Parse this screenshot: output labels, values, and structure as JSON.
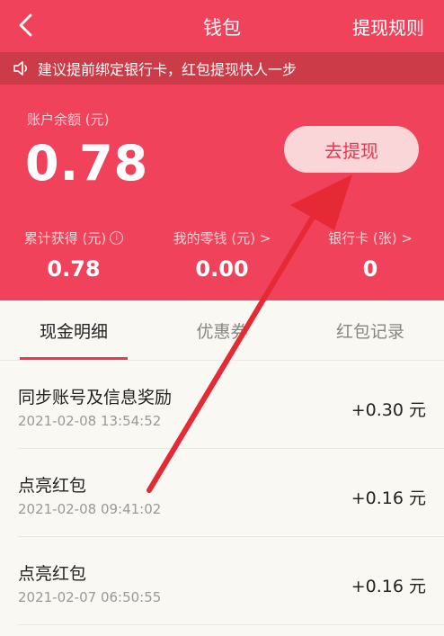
{
  "header": {
    "title": "钱包",
    "rules_label": "提现规则"
  },
  "notice": {
    "text": "建议提前绑定银行卡，红包提现快人一步"
  },
  "wallet": {
    "balance_label": "账户余额 (元)",
    "balance_value": "0.78",
    "withdraw_label": "去提现",
    "stats": [
      {
        "label": "累计获得 (元)",
        "value": "0.78"
      },
      {
        "label": "我的零钱 (元) >",
        "value": "0.00"
      },
      {
        "label": "银行卡 (张) >",
        "value": "0"
      }
    ]
  },
  "tabs": [
    {
      "label": "现金明细",
      "active": true
    },
    {
      "label": "优惠券",
      "active": false
    },
    {
      "label": "红包记录",
      "active": false
    }
  ],
  "transactions": [
    {
      "title": "同步账号及信息奖励",
      "time": "2021-02-08 13:54:52",
      "amount": "+0.30 元"
    },
    {
      "title": "点亮红包",
      "time": "2021-02-08 09:41:02",
      "amount": "+0.16 元"
    },
    {
      "title": "点亮红包",
      "time": "2021-02-07 06:50:55",
      "amount": "+0.16 元"
    }
  ],
  "colors": {
    "brand_red": "#f0425a",
    "notice_bg": "#cc3c48",
    "annotation_arrow": "#e62a35"
  }
}
